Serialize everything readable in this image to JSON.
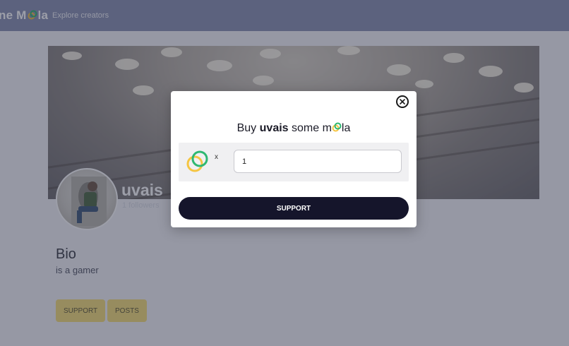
{
  "navbar": {
    "brand": {
      "prefix": "ne M",
      "suffix": "la"
    },
    "explore_link": "Explore creators"
  },
  "profile": {
    "username": "uvais",
    "followers": "1 followers",
    "bio_title": "Bio",
    "bio_text": "is a gamer",
    "support_label": "SUPPORT",
    "posts_label": "POSTS"
  },
  "modal": {
    "title": {
      "buy": "Buy",
      "name": "uvais",
      "some": "some",
      "m": "m",
      "la": "la"
    },
    "times_symbol": "x",
    "quantity_value": "1",
    "support_label": "SUPPORT"
  },
  "colors": {
    "navbar": "#8b93b2",
    "primary_button": "#15152b",
    "secondary_button": "#f6df7a",
    "logo_green": "#2eb872",
    "logo_yellow": "#f5c542"
  }
}
